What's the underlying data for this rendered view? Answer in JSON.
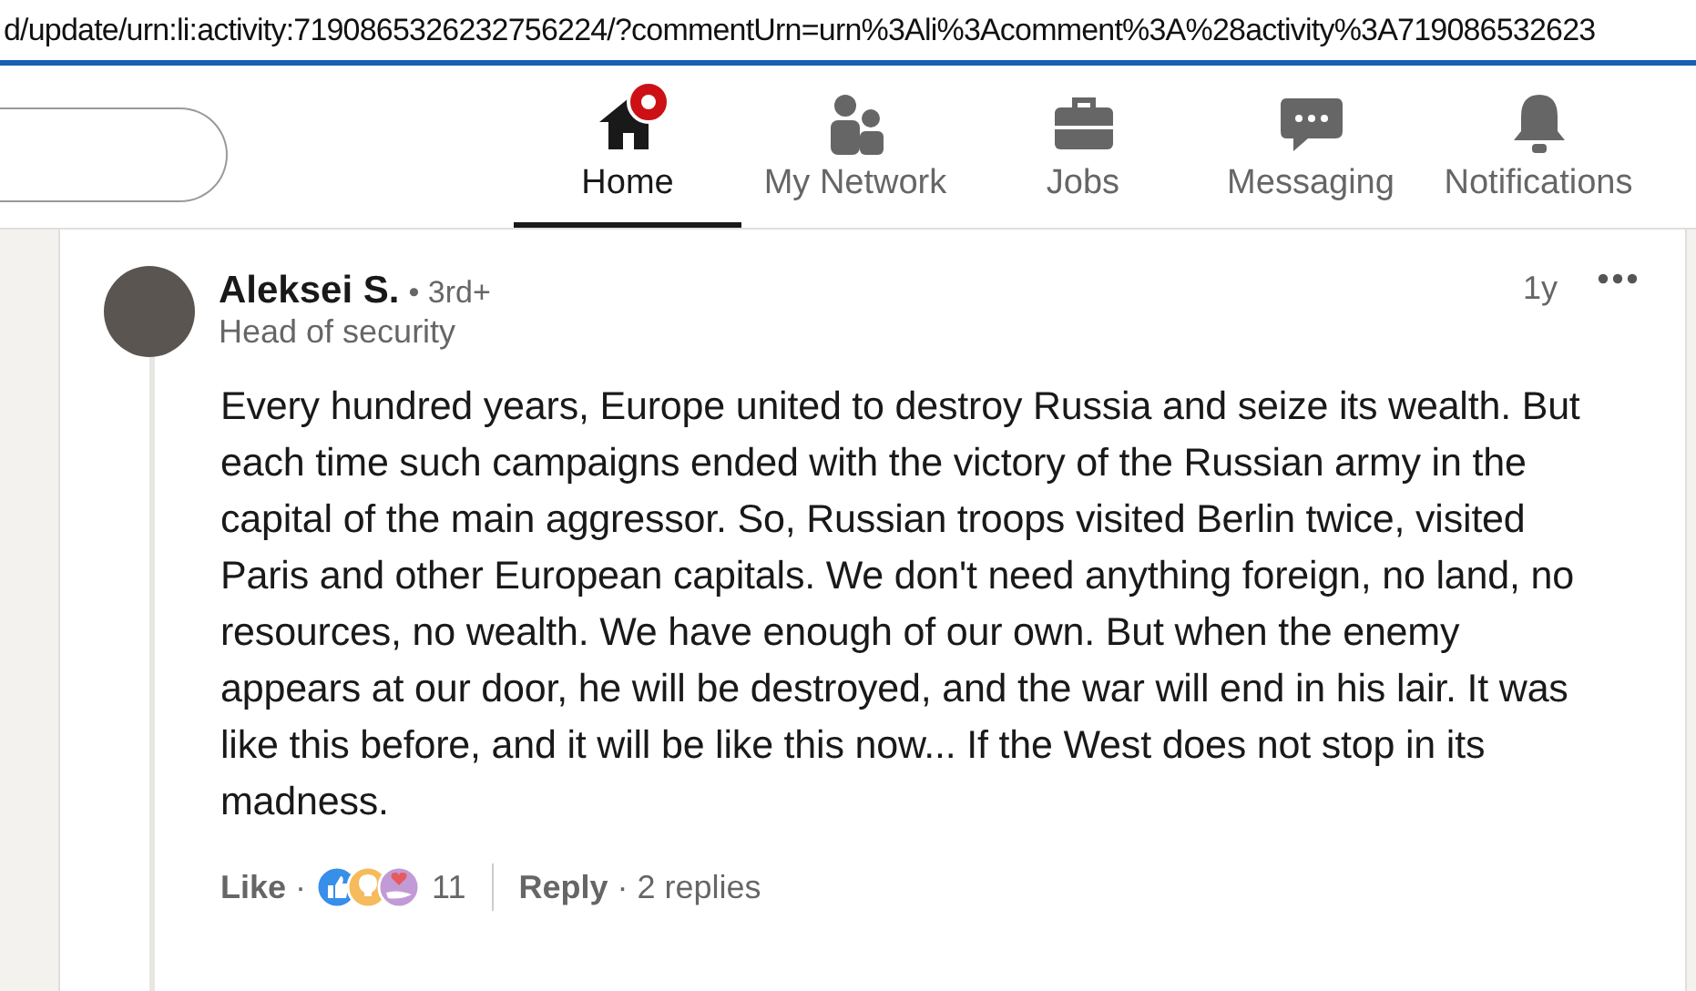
{
  "address_bar": {
    "value": "d/update/urn:li:activity:7190865326232756224/?commentUrn=urn%3Ali%3Acomment%3A%28activity%3A719086532623"
  },
  "nav": {
    "items": [
      {
        "kind": "home",
        "label": "Home",
        "selected": true,
        "badge": true
      },
      {
        "kind": "network",
        "label": "My Network",
        "selected": false,
        "badge": false
      },
      {
        "kind": "jobs",
        "label": "Jobs",
        "selected": false,
        "badge": false
      },
      {
        "kind": "messaging",
        "label": "Messaging",
        "selected": false,
        "badge": false
      },
      {
        "kind": "notifications",
        "label": "Notifications",
        "selected": false,
        "badge": false
      }
    ]
  },
  "comment": {
    "author": "Aleksei S.",
    "degree": "• 3rd+",
    "headline": "Head of security",
    "time": "1y",
    "body": "Every hundred years, Europe united to destroy Russia and seize its wealth. But each time such campaigns ended with the victory of the Russian army in the capital of the main aggressor. So, Russian troops visited Berlin twice, visited Paris and other European capitals. We don't need anything foreign, no land, no resources, no wealth. We have enough of our own. But when the enemy appears at our door, he will be destroyed, and the war will end in his lair. It was like this before, and it will be like this now... If the West does not stop in its madness.",
    "like": "Like",
    "like_separator": "·",
    "reaction_count": "11",
    "reply": "Reply",
    "reply_separator": "·",
    "replies": "2 replies"
  }
}
